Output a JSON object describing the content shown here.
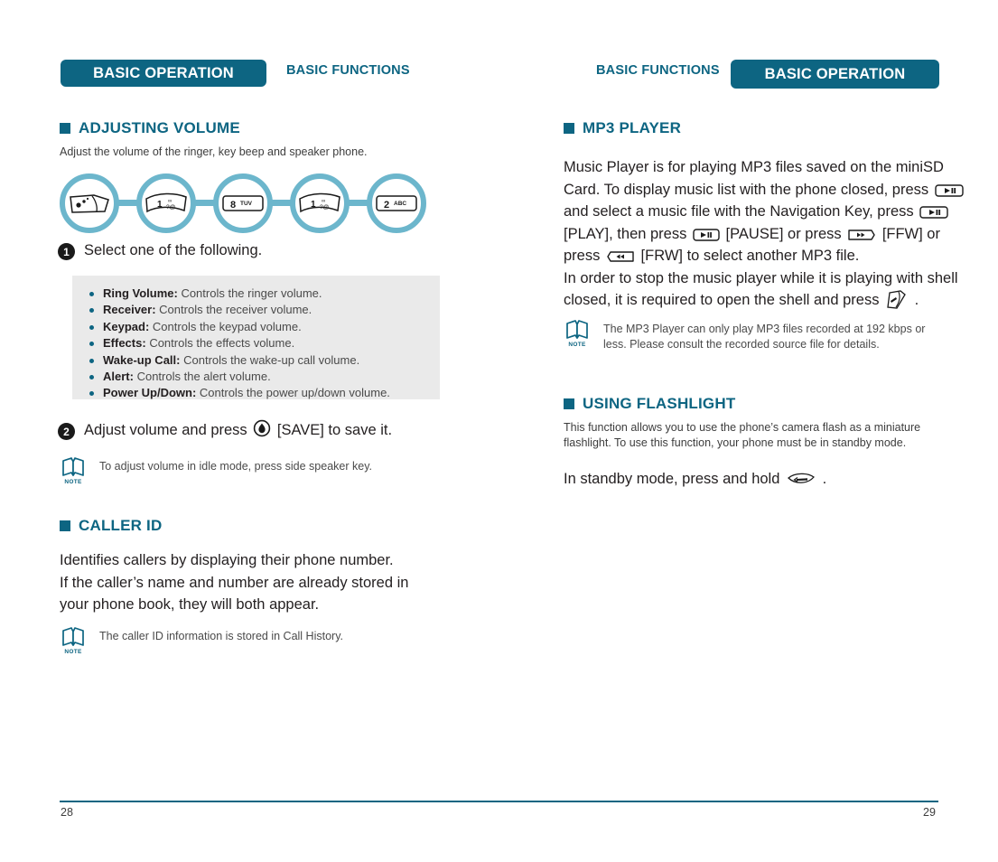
{
  "left_page": {
    "header": {
      "pill_label": "BASIC OPERATION",
      "plain_label": "BASIC FUNCTIONS"
    },
    "sections": [
      {
        "title": "ADJUSTING VOLUME",
        "intro": "Adjust the volume of the ringer, key beep and speaker phone.",
        "key_sequence": [
          {
            "icon": "menu-key-icon",
            "label": ""
          },
          {
            "icon": "keypad-1-key-icon",
            "label": "1"
          },
          {
            "icon": "keypad-8-key-icon",
            "label": "8",
            "sub": "TUV"
          },
          {
            "icon": "keypad-1-key-icon",
            "label": "1"
          },
          {
            "icon": "keypad-2-key-icon",
            "label": "2",
            "sub": "ABC"
          }
        ],
        "step1": {
          "number": "1",
          "text": "Select one of the following."
        },
        "options": [
          {
            "label": "Ring Volume:",
            "desc": "Controls the ringer volume."
          },
          {
            "label": "Receiver:",
            "desc": "Controls the receiver volume."
          },
          {
            "label": "Keypad:",
            "desc": "Controls the keypad volume."
          },
          {
            "label": "Effects:",
            "desc": "Controls the effects volume."
          },
          {
            "label": "Wake-up Call:",
            "desc": "Controls the wake-up call volume."
          },
          {
            "label": "Alert:",
            "desc": "Controls the alert volume."
          },
          {
            "label": "Power Up/Down:",
            "desc": "Controls the power up/down volume."
          }
        ],
        "step2": {
          "number": "2",
          "text_before": "Adjust volume and press",
          "text_after": "[SAVE] to save it."
        },
        "note": {
          "label": "NOTE",
          "text": "To adjust volume in idle mode, press side speaker key."
        }
      },
      {
        "title": "CALLER ID",
        "body_line1": "Identifies callers by displaying their phone number.",
        "body_line2": "If the caller’s name and number are already stored in",
        "body_line3": "your phone book, they will both appear.",
        "note": {
          "label": "NOTE",
          "text": "The caller ID information is stored in Call History."
        }
      }
    ],
    "page_number": "28"
  },
  "right_page": {
    "header": {
      "pill_label": "BASIC OPERATION",
      "plain_label": "BASIC FUNCTIONS"
    },
    "sections": [
      {
        "title": "MP3 PLAYER",
        "body": {
          "line1": "Music Player is for playing MP3 files saved on the miniSD",
          "line2a": "Card. To display music list with the phone closed, press",
          "line3a": "and select a music file with the Navigation Key, press",
          "line4a": "[PLAY], then press",
          "line4b": "[PAUSE] or press",
          "line4c": "[FFW] or",
          "line5a": "press",
          "line5b": "[FRW] to select another MP3 file.",
          "line6": "In order to stop the music player while it is playing with shell",
          "line7a": "closed, it is required to open the shell and press",
          "line7b": "."
        },
        "note": {
          "label": "NOTE",
          "line1": "The MP3 Player can only play MP3 files recorded at 192 kbps or",
          "line2": "less. Please consult the recorded source file for details."
        }
      },
      {
        "title": "USING FLASHLIGHT",
        "intro_line1": "This function allows you to use the phone’s camera flash as a miniature",
        "intro_line2": "flashlight. To use this function, your phone must be in standby mode.",
        "instruction_before": "In standby mode, press and hold",
        "instruction_after": "."
      }
    ],
    "page_number": "29"
  },
  "colors": {
    "accent": "#0d6582",
    "key_circle": "#6cb6cc",
    "box_bg": "#eaeaea"
  }
}
